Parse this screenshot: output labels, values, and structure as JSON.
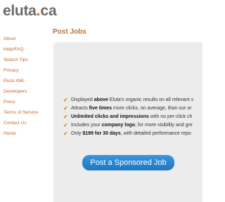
{
  "logo": {
    "main": "eluta",
    "dot": ".",
    "tld": "ca"
  },
  "sidebar": {
    "items": [
      {
        "label": "About"
      },
      {
        "label": "Help/FAQ"
      },
      {
        "label": "Search Tips"
      },
      {
        "label": "Privacy"
      },
      {
        "label": "Eluta XML"
      },
      {
        "label": "Developers"
      },
      {
        "label": "Press"
      },
      {
        "label": "Terms of Service"
      },
      {
        "label": "Contact Us"
      },
      {
        "label": "Home"
      }
    ]
  },
  "main": {
    "title": "Post Jobs",
    "features": [
      {
        "pre": "Displayed ",
        "bold": "above",
        "post": " Eluta's organic results on all relevant s"
      },
      {
        "pre": "Attracts ",
        "bold": "five times",
        "post": " more clicks, on average, than our or"
      },
      {
        "pre": "",
        "bold": "Unlimited clicks and impressions",
        "post": " with no per-click ch"
      },
      {
        "pre": "Includes your ",
        "bold": "company logo",
        "post": ", for more visibility and gre"
      },
      {
        "pre": "Only ",
        "bold": "$199 for 30 days",
        "post": ", with detailed performance repo"
      }
    ],
    "cta_label": "Post a Sponsored Job"
  },
  "colors": {
    "link": "#c6682a",
    "title": "#b9723a",
    "panel_bg": "#ececed",
    "check": "#e0922a",
    "button": "#2b87cf"
  },
  "icons": {
    "feature_bullet": "checkmark-icon"
  }
}
